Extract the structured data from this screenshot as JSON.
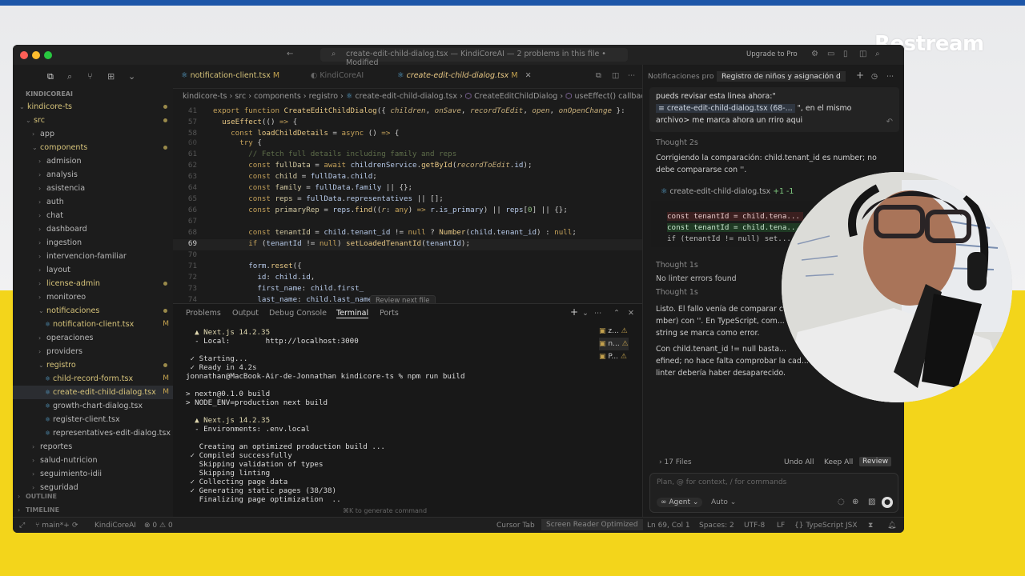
{
  "brand": {
    "name": "Restream"
  },
  "window": {
    "title": "create-edit-child-dialog.tsx — KindiCoreAI — 2 problems in this file • Modified",
    "upgrade_label": "Upgrade to Pro"
  },
  "sidebar": {
    "root": "KINDICOREAI",
    "items": [
      {
        "label": "kindicore-ts",
        "color": "#d6c37a"
      },
      {
        "label": "src",
        "color": "#d6c37a"
      },
      {
        "label": "app",
        "color": "#b8b8b8"
      },
      {
        "label": "components",
        "color": "#d6c37a"
      },
      {
        "label": "admision",
        "color": "#b8b8b8"
      },
      {
        "label": "analysis",
        "color": "#b8b8b8"
      },
      {
        "label": "asistencia",
        "color": "#b8b8b8"
      },
      {
        "label": "auth",
        "color": "#b8b8b8"
      },
      {
        "label": "chat",
        "color": "#b8b8b8"
      },
      {
        "label": "dashboard",
        "color": "#b8b8b8"
      },
      {
        "label": "ingestion",
        "color": "#b8b8b8"
      },
      {
        "label": "intervencion-familiar",
        "color": "#b8b8b8"
      },
      {
        "label": "layout",
        "color": "#b8b8b8"
      },
      {
        "label": "license-admin",
        "color": "#d6c37a"
      },
      {
        "label": "monitoreo",
        "color": "#b8b8b8"
      },
      {
        "label": "notificaciones",
        "color": "#d6c37a"
      },
      {
        "label": "notification-client.tsx",
        "color": "#d6c37a",
        "badge": "M"
      },
      {
        "label": "operaciones",
        "color": "#b8b8b8"
      },
      {
        "label": "providers",
        "color": "#b8b8b8"
      },
      {
        "label": "registro",
        "color": "#d6c37a"
      },
      {
        "label": "child-record-form.tsx",
        "color": "#d6c37a",
        "badge": "M"
      },
      {
        "label": "create-edit-child-dialog.tsx",
        "color": "#d6c37a",
        "badge": "M"
      },
      {
        "label": "growth-chart-dialog.tsx",
        "color": "#b8b8b8"
      },
      {
        "label": "register-client.tsx",
        "color": "#b8b8b8"
      },
      {
        "label": "representatives-edit-dialog.tsx",
        "color": "#b8b8b8"
      },
      {
        "label": "reportes",
        "color": "#b8b8b8"
      },
      {
        "label": "salud-nutricion",
        "color": "#b8b8b8"
      },
      {
        "label": "seguimiento-idii",
        "color": "#b8b8b8"
      },
      {
        "label": "seguridad",
        "color": "#b8b8b8"
      }
    ],
    "outline": "OUTLINE",
    "timeline": "TIMELINE"
  },
  "editor": {
    "tabs": [
      {
        "label": "notification-client.tsx",
        "badge": "M"
      },
      {
        "label": "KindiCoreAI",
        "badge": ""
      },
      {
        "label": "create-edit-child-dialog.tsx",
        "badge": "M"
      }
    ],
    "breadcrumb": [
      "kindicore-ts",
      "src",
      "components",
      "registro",
      "create-edit-child-dialog.tsx",
      "CreateEditChildDialog",
      "useEffect() callback"
    ],
    "line_numbers": [
      "41",
      "57",
      "58",
      "61",
      "62",
      "63",
      "64",
      "65",
      "66",
      "67",
      "68",
      "69",
      "70",
      "71",
      "72",
      "73",
      "74"
    ],
    "hover_hint": "Review next file"
  },
  "panel": {
    "tabs": [
      "Problems",
      "Output",
      "Debug Console",
      "Terminal",
      "Ports"
    ],
    "terminal_lines": [
      "  ▲ Next.js 14.2.35",
      "  - Local:        http://localhost:3000",
      "",
      " ✓ Starting...",
      " ✓ Ready in 4.2s",
      "jonnathan@MacBook-Air-de-Jonnathan kindicore-ts % npm run build",
      "",
      "> nextn@0.1.0 build",
      "> NODE_ENV=production next build",
      "",
      "  ▲ Next.js 14.2.35",
      "  - Environments: .env.local",
      "",
      "   Creating an optimized production build ...",
      " ✓ Compiled successfully",
      "   Skipping validation of types",
      "   Skipping linting",
      " ✓ Collecting page data",
      " ✓ Generating static pages (38/38)",
      "   Finalizing page optimization  .."
    ],
    "generate_hint": "⌘K to generate command",
    "terminal_list": [
      {
        "label": "z..."
      },
      {
        "label": "n..."
      },
      {
        "label": "P..."
      }
    ]
  },
  "chat": {
    "tabs": [
      "Notificaciones pro",
      "Registro de niños y asignación d"
    ],
    "quote_line1": "pueds revisar esta linea ahora:\"",
    "file_ref": "create-edit-child-dialog.tsx (68-...",
    "quote_line1b": "\", en el mismo",
    "quote_line2": "archivo> me marca ahora un rriro aqui",
    "thought1": "Thought 2s",
    "fix_line1": "Corrigiendo la comparación: child.tenant_id es number; no",
    "fix_line2": "debe compararse con ''.",
    "diff_file": "create-edit-child-dialog.tsx",
    "diff_stats": "+1 -1",
    "diff_lines": [
      {
        "text": "const tenantId = child.tena...",
        "kind": "del"
      },
      {
        "text": "const tenantId = child.tena...",
        "kind": "add"
      },
      {
        "text": "if (tenantId != null) set...",
        "kind": "ctx"
      }
    ],
    "thought2": "Thought 1s",
    "linter": "No linter errors found",
    "thought3": "Thought 1s",
    "answer_lines": [
      "Listo. El fallo venía de comparar  c...",
      "mber) con ''. En TypeScript, com...",
      "string se marca como error.",
      "Con child.tenant_id != null basta...",
      "efined; no hace falta comprobar la cad...",
      "linter debería haber desaparecido."
    ],
    "files_count": "17 Files",
    "undo_all": "Undo All",
    "keep_all": "Keep All",
    "review": "Review",
    "input_placeholder": "Plan, @ for context, / for commands",
    "agent_label": "Agent",
    "auto_label": "Auto"
  },
  "statusbar": {
    "branch": "main*+",
    "project": "KindiCoreAI",
    "errors": "0",
    "warnings": "0",
    "cursor_tab": "Cursor Tab",
    "screen_reader": "Screen Reader Optimized",
    "position": "Ln 69, Col 1",
    "spaces": "Spaces: 2",
    "encoding": "UTF-8",
    "eol": "LF",
    "language": "TypeScript JSX"
  }
}
